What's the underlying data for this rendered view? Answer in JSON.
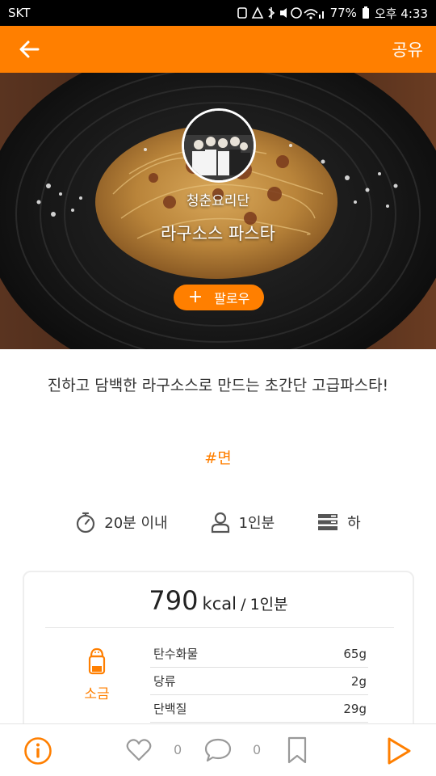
{
  "status_bar": {
    "carrier": "SKT",
    "battery": "77%",
    "time": "오후 4:33"
  },
  "app_bar": {
    "share_label": "공유"
  },
  "hero": {
    "channel_name": "청춘요리단",
    "recipe_title": "라구소스 파스타",
    "follow_label": "팔로우"
  },
  "description": "진하고 담백한 라구소스로 만드는 초간단 고급파스타!",
  "hashtag": "#면",
  "info": {
    "time": "20분 이내",
    "serving": "1인분",
    "difficulty": "하"
  },
  "nutrition": {
    "kcal": "790",
    "kcal_unit": "kcal",
    "separator": "/",
    "per_serving": "1인분",
    "salt_label": "소금",
    "rows": [
      {
        "name": "탄수화물",
        "value": "65g"
      },
      {
        "name": "당류",
        "value": "2g"
      },
      {
        "name": "단백질",
        "value": "29g"
      }
    ]
  },
  "bottom_bar": {
    "like_count": "0",
    "comment_count": "0"
  },
  "colors": {
    "accent": "#ff7f00",
    "status_bar": "#000000"
  }
}
